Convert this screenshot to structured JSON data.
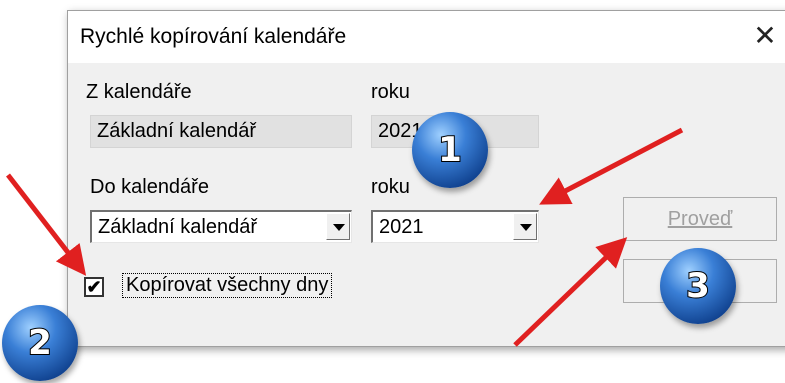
{
  "dialog": {
    "title": "Rychlé kopírování kalendáře",
    "close_glyph": "✕"
  },
  "source": {
    "calendar_label": "Z kalendáře",
    "year_label": "roku",
    "calendar_value": "Základní kalendář",
    "year_value": "2021"
  },
  "target": {
    "calendar_label": "Do kalendáře",
    "year_label": "roku",
    "calendar_value": "Základní kalendář",
    "year_value": "2021"
  },
  "options": {
    "copy_all_label": "Kopírovat všechny dny",
    "copy_all_checked": true,
    "check_glyph": "✔"
  },
  "buttons": {
    "execute_label": "Proveď",
    "execute_enabled": false
  },
  "annotations": {
    "badges": [
      "1",
      "2",
      "3"
    ],
    "arrow_color": "#e02020",
    "badge_color": "#1f5bb5"
  }
}
